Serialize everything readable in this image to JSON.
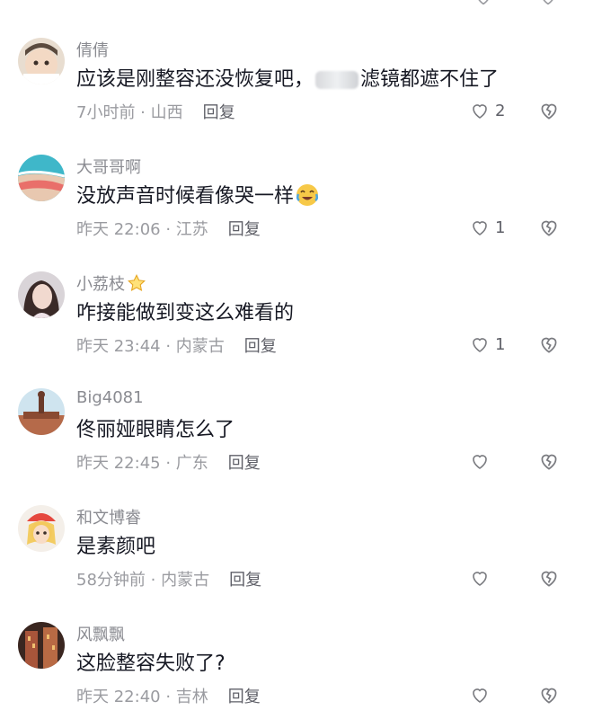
{
  "comments": [
    {
      "username": "倩倩",
      "text_before": "应该是刚整容还没恢复吧，",
      "text_after": "滤镜都遮不住了",
      "time": "7小时前",
      "location": "山西",
      "reply": "回复",
      "likes": "2",
      "avatar": "baby"
    },
    {
      "username": "大哥哥啊",
      "text": "没放声音时候看像哭一样",
      "time": "昨天 22:06",
      "location": "江苏",
      "reply": "回复",
      "likes": "1",
      "avatar": "beach"
    },
    {
      "username": "小荔枝",
      "text": "咋接能做到变这么难看的",
      "time": "昨天 23:44",
      "location": "内蒙古",
      "reply": "回复",
      "likes": "1",
      "avatar": "girl"
    },
    {
      "username": "Big4081",
      "text": "佟丽娅眼睛怎么了",
      "time": "昨天 22:45",
      "location": "广东",
      "reply": "回复",
      "likes": "",
      "avatar": "statue"
    },
    {
      "username": "和文博睿",
      "text": "是素颜吧",
      "time": "58分钟前",
      "location": "内蒙古",
      "reply": "回复",
      "likes": "",
      "avatar": "princess"
    },
    {
      "username": "风飘飘",
      "text": "这脸整容失败了?",
      "time": "昨天 22:40",
      "location": "吉林",
      "reply": "回复",
      "likes": "",
      "avatar": "building"
    }
  ],
  "icons": {
    "like": "heart-outline-icon",
    "dislike": "broken-heart-icon"
  },
  "colors": {
    "username": "#8a8b91",
    "text": "#161823",
    "meta": "#9a9ba0",
    "reply": "#5f6068"
  }
}
